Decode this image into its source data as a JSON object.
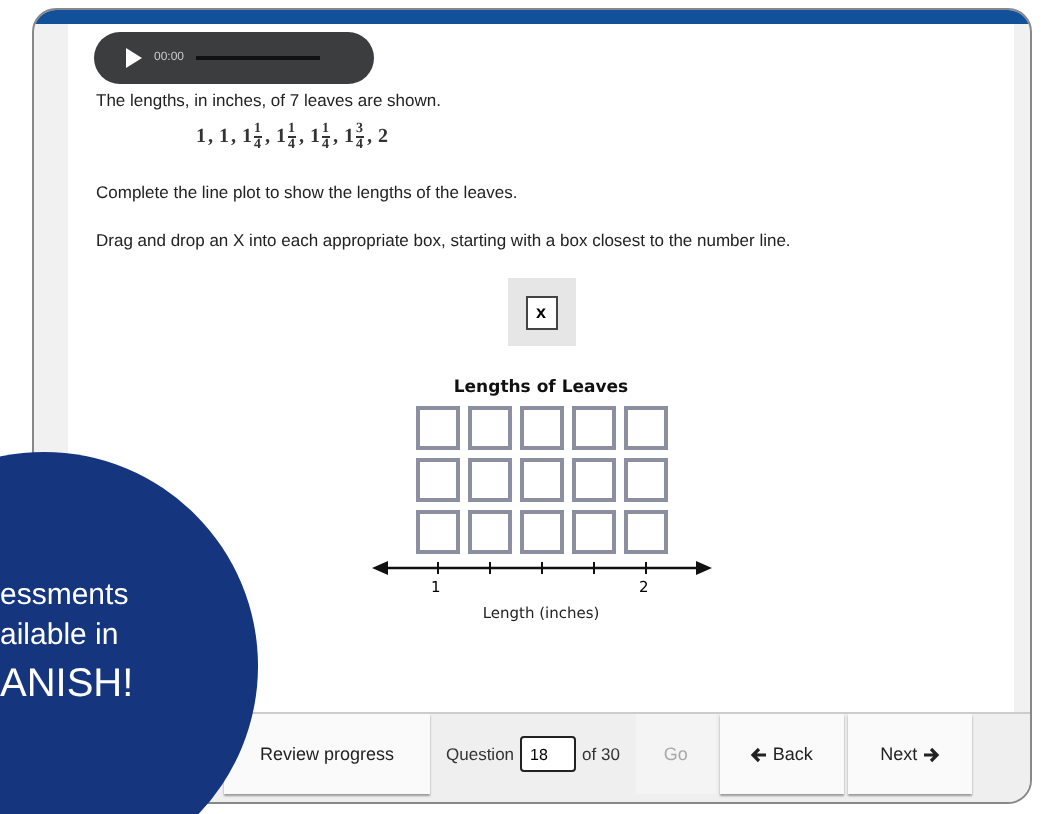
{
  "audio_player": {
    "time": "00:00"
  },
  "prompt": "The lengths, in inches, of 7 leaves are shown.",
  "separator": ",",
  "values": [
    {
      "whole": "1"
    },
    {
      "whole": "1"
    },
    {
      "whole": "1",
      "num": "1",
      "den": "4"
    },
    {
      "whole": "1",
      "num": "1",
      "den": "4"
    },
    {
      "whole": "1",
      "num": "1",
      "den": "4"
    },
    {
      "whole": "1",
      "num": "3",
      "den": "4"
    },
    {
      "whole": "2"
    }
  ],
  "instruction_1": "Complete the line plot to show the lengths of the leaves.",
  "instruction_2": "Drag and drop an X into each appropriate box, starting with a box closest to the number line.",
  "draggable_tile": "x",
  "line_plot": {
    "title": "Lengths of Leaves",
    "axis_labels": [
      "1",
      "2"
    ],
    "xlabel": "Length (inches)"
  },
  "promo_badge": {
    "lines": [
      "essments",
      "ailable in",
      "ANISH!"
    ]
  },
  "toolbar": {
    "review_button": "Review progress",
    "question_label": "Question",
    "question_value": "18",
    "question_total": "of 30",
    "go_button": {
      "label": "Go",
      "disabled": true
    },
    "back_button": "Back",
    "next_button": "Next"
  }
}
